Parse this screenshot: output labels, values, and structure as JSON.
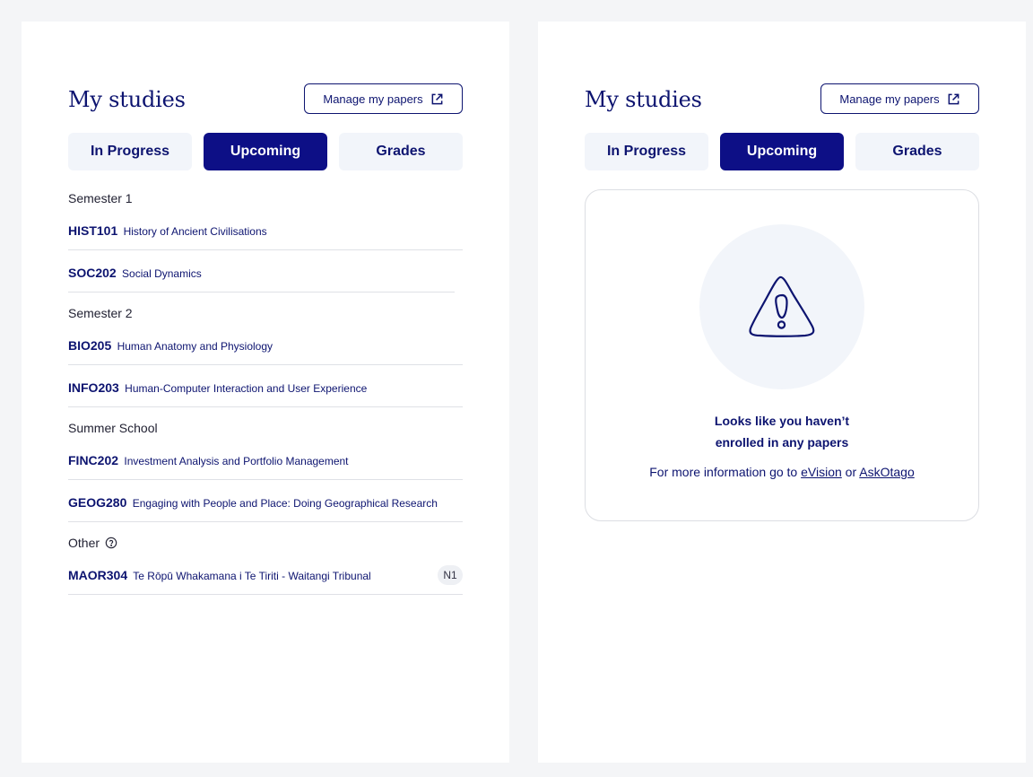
{
  "left_panel": {
    "title": "My studies",
    "manage_label": "Manage my papers",
    "tabs": [
      {
        "label": "In Progress",
        "active": false
      },
      {
        "label": "Upcoming",
        "active": true
      },
      {
        "label": "Grades",
        "active": false
      }
    ],
    "groups": [
      {
        "heading": "Semester 1",
        "papers": [
          {
            "code": "HIST101",
            "name": "History of Ancient Civilisations"
          },
          {
            "code": "SOC202",
            "name": "Social Dynamics"
          }
        ]
      },
      {
        "heading": "Semester 2",
        "papers": [
          {
            "code": "BIO205",
            "name": "Human Anatomy and Physiology"
          },
          {
            "code": "INFO203",
            "name": "Human-Computer Interaction and User Experience"
          }
        ]
      },
      {
        "heading": "Summer School",
        "papers": [
          {
            "code": "FINC202",
            "name": "Investment Analysis and Portfolio Management"
          },
          {
            "code": "GEOG280",
            "name": "Engaging with People and Place: Doing Geographical Research"
          }
        ]
      },
      {
        "heading": "Other",
        "papers": [
          {
            "code": "MAOR304",
            "name": "Te Rōpū Whakamana i Te Tiriti - Waitangi Tribunal",
            "badge": "N1"
          }
        ]
      }
    ]
  },
  "right_panel": {
    "title": "My studies",
    "manage_label": "Manage my papers",
    "tabs": [
      {
        "label": "In Progress",
        "active": false
      },
      {
        "label": "Upcoming",
        "active": true
      },
      {
        "label": "Grades",
        "active": false
      }
    ],
    "empty_state": {
      "title_line1": "Looks like you haven’t",
      "title_line2": "enrolled in any papers",
      "info_prefix": "For more information go to",
      "link1": "eVision",
      "connector": "or",
      "link2": "AskOtago"
    }
  },
  "colors": {
    "primary": "#0d0f86",
    "text_dark_blue": "#0d1470",
    "tab_bg": "#f2f5fa",
    "page_bg": "#f4f5f7"
  },
  "icons": {
    "external_link": "external-link-icon",
    "help": "help-circle-icon",
    "warning": "warning-triangle-icon"
  }
}
